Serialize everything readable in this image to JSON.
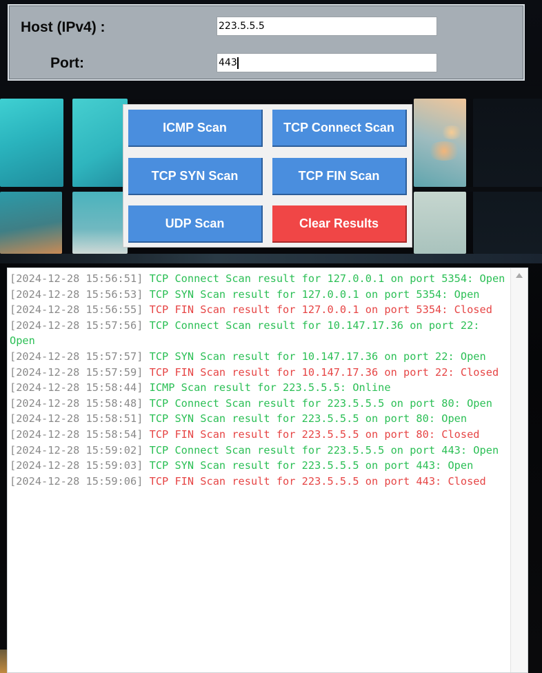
{
  "form": {
    "host_label": "Host (IPv4) :",
    "host_value": "223.5.5.5",
    "port_label": "Port:",
    "port_value": "443"
  },
  "buttons": {
    "icmp": "ICMP Scan",
    "tcp_connect": "TCP Connect Scan",
    "tcp_syn": "TCP SYN Scan",
    "tcp_fin": "TCP FIN Scan",
    "udp": "UDP Scan",
    "clear": "Clear Results"
  },
  "colors": {
    "button_blue": "#4a8ede",
    "button_red": "#f04646",
    "log_success": "#2bbf55",
    "log_failure": "#e64545",
    "log_timestamp": "#8a8a8a"
  },
  "log": [
    {
      "time": "[2024-12-28 15:56:51]",
      "message": "TCP Connect Scan result for 127.0.0.1 on port 5354: Open",
      "status": "ok"
    },
    {
      "time": "[2024-12-28 15:56:53]",
      "message": "TCP SYN Scan result for 127.0.0.1 on port 5354: Open",
      "status": "ok"
    },
    {
      "time": "[2024-12-28 15:56:55]",
      "message": "TCP FIN Scan result for 127.0.0.1 on port 5354: Closed",
      "status": "fail"
    },
    {
      "time": "[2024-12-28 15:57:56]",
      "message": "TCP Connect Scan result for 10.147.17.36 on port 22: Open",
      "status": "ok"
    },
    {
      "time": "[2024-12-28 15:57:57]",
      "message": "TCP SYN Scan result for 10.147.17.36 on port 22: Open",
      "status": "ok"
    },
    {
      "time": "[2024-12-28 15:57:59]",
      "message": "TCP FIN Scan result for 10.147.17.36 on port 22: Closed",
      "status": "fail"
    },
    {
      "time": "[2024-12-28 15:58:44]",
      "message": "ICMP Scan result for 223.5.5.5: Online",
      "status": "ok"
    },
    {
      "time": "[2024-12-28 15:58:48]",
      "message": "TCP Connect Scan result for 223.5.5.5 on port 80: Open",
      "status": "ok"
    },
    {
      "time": "[2024-12-28 15:58:51]",
      "message": "TCP SYN Scan result for 223.5.5.5 on port 80: Open",
      "status": "ok"
    },
    {
      "time": "[2024-12-28 15:58:54]",
      "message": "TCP FIN Scan result for 223.5.5.5 on port 80: Closed",
      "status": "fail"
    },
    {
      "time": "[2024-12-28 15:59:02]",
      "message": "TCP Connect Scan result for 223.5.5.5 on port 443: Open",
      "status": "ok"
    },
    {
      "time": "[2024-12-28 15:59:03]",
      "message": "TCP SYN Scan result for 223.5.5.5 on port 443: Open",
      "status": "ok"
    },
    {
      "time": "[2024-12-28 15:59:06]",
      "message": "TCP FIN Scan result for 223.5.5.5 on port 443: Closed",
      "status": "fail"
    }
  ]
}
